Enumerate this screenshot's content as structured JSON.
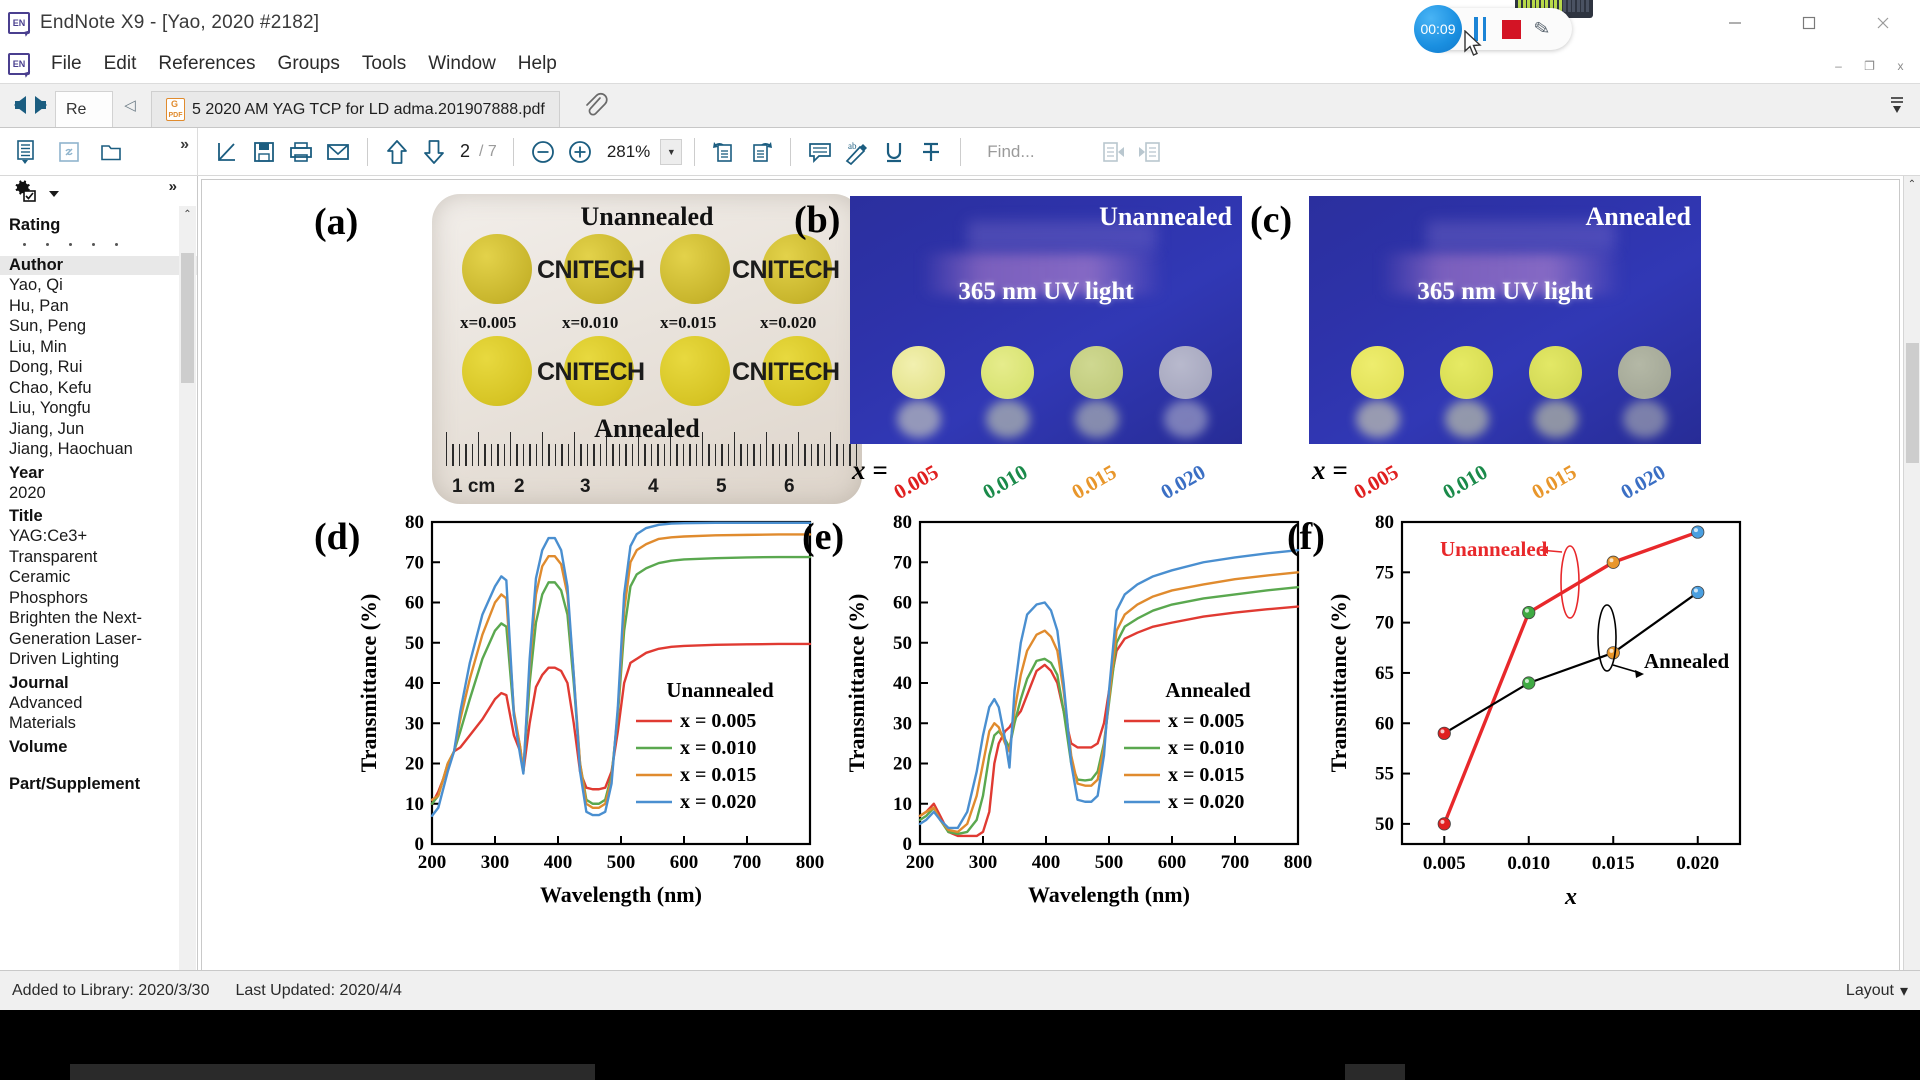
{
  "window": {
    "app_logo": "endnote-logo",
    "title": "EndNote X9 - [Yao, 2020 #2182]",
    "minimize": "—",
    "maximize": "□",
    "close": "✕",
    "doc_minimize": "–",
    "doc_restore": "❐",
    "doc_close": "x"
  },
  "menu": {
    "items": [
      "File",
      "Edit",
      "References",
      "Groups",
      "Tools",
      "Window",
      "Help"
    ]
  },
  "tabbar": {
    "back_icon": "back-arrow-icon",
    "forward_icon": "forward-arrow-icon",
    "reference_tab": "Re",
    "collapse_icon": "collapse-left-icon",
    "pdf_tab": "5 2020 AM YAG TCP for LD adma.201907888.pdf",
    "pdf_badge": "PDF",
    "attachment_icon": "paperclip-icon",
    "overflow_icon": "overflow-menu-icon"
  },
  "library_toolbar": {
    "icons": [
      "list-view-icon",
      "link-icon",
      "open-folder-icon"
    ],
    "overflow": "»"
  },
  "pdf_toolbar": {
    "icons": {
      "open_external": "open-in-new-icon",
      "save": "save-icon",
      "print": "print-icon",
      "email": "email-icon",
      "prev_page": "up-arrow-icon",
      "next_page": "down-arrow-icon",
      "zoom_out": "zoom-out-icon",
      "zoom_in": "zoom-in-icon",
      "zoom_dropdown": "chevron-down-icon",
      "rotate_left": "rotate-left-icon",
      "rotate_right": "rotate-right-icon",
      "sticky_note": "sticky-note-icon",
      "highlight": "highlight-pen-icon",
      "underline": "underline-icon",
      "strikethrough": "strikethrough-icon",
      "find_prev": "find-previous-icon",
      "find_next": "find-next-icon"
    },
    "page_current": "2",
    "page_total": "/ 7",
    "zoom_level": "281%",
    "find_placeholder": "Find..."
  },
  "left_panel": {
    "settings_icon": "gear-settings-icon",
    "dropdown_icon": "chevron-down-icon",
    "overflow": "»",
    "fields": [
      {
        "label": "Rating",
        "type": "rating",
        "dots": 5
      },
      {
        "label": "Author",
        "highlight": true,
        "values": [
          "Yao, Qi",
          "Hu, Pan",
          "Sun, Peng",
          "Liu, Min",
          "Dong, Rui",
          "Chao, Kefu",
          "Liu, Yongfu",
          "Jiang, Jun",
          "Jiang, Haochuan"
        ]
      },
      {
        "label": "Year",
        "values": [
          "2020"
        ]
      },
      {
        "label": "Title",
        "values": [
          "YAG:Ce3+",
          " Transparent",
          "Ceramic",
          "Phosphors",
          "Brighten the Next-",
          "Generation Laser-",
          "Driven Lighting"
        ]
      },
      {
        "label": "Journal",
        "values": [
          "Advanced",
          "Materials"
        ]
      },
      {
        "label": "Volume",
        "values": [
          ""
        ]
      },
      {
        "label": "Part/Supplement",
        "values": []
      }
    ]
  },
  "status_bar": {
    "added": "Added to Library: 2020/3/30",
    "updated": "Last Updated: 2020/4/4",
    "layout": "Layout",
    "layout_caret": "▾"
  },
  "recorder": {
    "timer": "00:09",
    "pause_icon": "pause-icon",
    "stop_icon": "stop-record-icon",
    "pen_icon": "pencil-annotate-icon"
  },
  "figure": {
    "panels": {
      "a": {
        "label": "(a)",
        "top_title": "Unannealed",
        "bottom_title": "Annealed",
        "logo_text": "CNITECH",
        "x_labels": [
          "x=0.005",
          "x=0.010",
          "x=0.015",
          "x=0.020"
        ],
        "ruler_numbers": [
          "1 cm",
          "2",
          "3",
          "4",
          "5",
          "6"
        ]
      },
      "b": {
        "label": "(b)",
        "title": "Unannealed",
        "uv_text": "365 nm UV light",
        "x_prefix": "x =",
        "x_values": [
          "0.005",
          "0.010",
          "0.015",
          "0.020"
        ],
        "x_colors": [
          "#e02020",
          "#1a8a4a",
          "#e8962b",
          "#3b6fc4"
        ]
      },
      "c": {
        "label": "(c)",
        "title": "Annealed",
        "uv_text": "365 nm UV light",
        "x_prefix": "x =",
        "x_values": [
          "0.005",
          "0.010",
          "0.015",
          "0.020"
        ],
        "x_colors": [
          "#e02020",
          "#1a8a4a",
          "#e8962b",
          "#3b6fc4"
        ]
      },
      "d": {
        "label": "(d)"
      },
      "e": {
        "label": "(e)"
      },
      "f": {
        "label": "(f)"
      }
    }
  },
  "chart_data": [
    {
      "id": "d",
      "type": "line",
      "title": "Unannealed",
      "xlabel": "Wavelength (nm)",
      "ylabel": "Transmittance (%)",
      "xlim": [
        200,
        800
      ],
      "ylim": [
        0,
        80
      ],
      "xticks": [
        200,
        300,
        400,
        500,
        600,
        700,
        800
      ],
      "yticks": [
        0,
        10,
        20,
        30,
        40,
        50,
        60,
        70,
        80
      ],
      "legend_position": "lower-right",
      "colors": [
        "#e03a32",
        "#5aa84f",
        "#e08b2e",
        "#4a8fd0"
      ],
      "x": [
        200,
        210,
        225,
        235,
        245,
        260,
        280,
        300,
        310,
        318,
        330,
        340,
        345,
        355,
        365,
        375,
        385,
        395,
        405,
        415,
        425,
        435,
        445,
        455,
        465,
        475,
        485,
        495,
        505,
        515,
        525,
        540,
        560,
        580,
        600,
        650,
        700,
        750,
        800
      ],
      "series": [
        {
          "name": "x = 0.005",
          "values": [
            10,
            13,
            19,
            23,
            24,
            27,
            31,
            36,
            37.5,
            37,
            27,
            23,
            18,
            30,
            39,
            42,
            43.8,
            43.8,
            43,
            40,
            30,
            18,
            14,
            13.6,
            13.6,
            14,
            18,
            28,
            40,
            45,
            46,
            47.5,
            48.5,
            49,
            49.2,
            49.5,
            49.6,
            49.7,
            49.7
          ]
        },
        {
          "name": "x = 0.010",
          "values": [
            10,
            12,
            20,
            23,
            28,
            36,
            46,
            53,
            54.8,
            54,
            32,
            24,
            18,
            40,
            55,
            62,
            65,
            65,
            63,
            57,
            40,
            20,
            11,
            10,
            10,
            11,
            17,
            32,
            53,
            64,
            67,
            68.5,
            69.8,
            70.4,
            70.7,
            71,
            71.2,
            71.3,
            71.3
          ]
        },
        {
          "name": "x = 0.015",
          "values": [
            11,
            12,
            20,
            23,
            31,
            41,
            52,
            60,
            62,
            61,
            33,
            24,
            18,
            44,
            62,
            69,
            71.5,
            71.5,
            69.5,
            62,
            42,
            20,
            10,
            9,
            9,
            10,
            16,
            33,
            58,
            70,
            73,
            74.5,
            75.8,
            76.2,
            76.4,
            76.7,
            76.8,
            76.9,
            76.9
          ]
        },
        {
          "name": "x = 0.020",
          "values": [
            7,
            9,
            18,
            23,
            33,
            45,
            57,
            64,
            66.5,
            65.5,
            32,
            22,
            17.5,
            46,
            66,
            73,
            76,
            76,
            73,
            64,
            42,
            18,
            8,
            7.2,
            7.2,
            8,
            15,
            34,
            62,
            74,
            77,
            78.5,
            79.3,
            79.6,
            79.7,
            79.8,
            79.8,
            79.8,
            79.8
          ]
        }
      ]
    },
    {
      "id": "e",
      "type": "line",
      "title": "Annealed",
      "xlabel": "Wavelength (nm)",
      "ylabel": "Transmittance (%)",
      "xlim": [
        200,
        800
      ],
      "ylim": [
        0,
        80
      ],
      "xticks": [
        200,
        300,
        400,
        500,
        600,
        700,
        800
      ],
      "yticks": [
        0,
        10,
        20,
        30,
        40,
        50,
        60,
        70,
        80
      ],
      "legend_position": "lower-right",
      "colors": [
        "#e03a32",
        "#5aa84f",
        "#e08b2e",
        "#4a8fd0"
      ],
      "x": [
        200,
        210,
        222,
        232,
        245,
        260,
        275,
        290,
        300,
        310,
        318,
        325,
        335,
        342,
        350,
        360,
        370,
        385,
        398,
        408,
        418,
        428,
        440,
        450,
        462,
        472,
        482,
        492,
        500,
        512,
        525,
        545,
        570,
        600,
        650,
        700,
        750,
        800
      ],
      "series": [
        {
          "name": "x = 0.005",
          "values": [
            7,
            8,
            10,
            7,
            3,
            2,
            2,
            2,
            3,
            8,
            20,
            25,
            28,
            29,
            31,
            33,
            37,
            43,
            44.5,
            43,
            40,
            33,
            25,
            24,
            24,
            24,
            25,
            30,
            38,
            48,
            51,
            52.5,
            54,
            55,
            56.5,
            57.5,
            58.3,
            59
          ]
        },
        {
          "name": "x = 0.010",
          "values": [
            6,
            7,
            9,
            6,
            3,
            2.5,
            3,
            6,
            12,
            22,
            27,
            28,
            26,
            24,
            30,
            36,
            41,
            45.5,
            46,
            45,
            42,
            33,
            20,
            16,
            15.8,
            16,
            18,
            25,
            35,
            50,
            54,
            56,
            58,
            59.5,
            61,
            62,
            63,
            63.8
          ]
        },
        {
          "name": "x = 0.015",
          "values": [
            7,
            8,
            9,
            6,
            3.5,
            3,
            5,
            12,
            20,
            28,
            30,
            29,
            25,
            23,
            33,
            42,
            48,
            52,
            53,
            51.5,
            48,
            38,
            22,
            15,
            14.5,
            14.5,
            16,
            24,
            36,
            53,
            57,
            59.5,
            61.5,
            63,
            64.5,
            65.8,
            66.7,
            67.5
          ]
        },
        {
          "name": "x = 0.020",
          "values": [
            5,
            6,
            8,
            6,
            4,
            4,
            8,
            18,
            27,
            34,
            36,
            34,
            26,
            19,
            38,
            50,
            57,
            59.5,
            60,
            58,
            53,
            40,
            20,
            11,
            10.5,
            10.5,
            12,
            22,
            38,
            58,
            62,
            64.5,
            66.5,
            68,
            70,
            71.2,
            72.2,
            73
          ]
        }
      ]
    },
    {
      "id": "f",
      "type": "line",
      "title": "",
      "xlabel": "x",
      "ylabel": "Transmittance (%)",
      "xlim": [
        0.0025,
        0.0225
      ],
      "ylim": [
        48,
        80
      ],
      "xticks": [
        0.005,
        0.01,
        0.015,
        0.02
      ],
      "xticklabels": [
        "0.005",
        "0.010",
        "0.015",
        "0.020"
      ],
      "yticks": [
        50,
        55,
        60,
        65,
        70,
        75,
        80
      ],
      "annotations": [
        "Unannealed",
        "Annealed"
      ],
      "annotation_colors": [
        "#e8282b",
        "#000000"
      ],
      "marker_colors": [
        "#e02020",
        "#3faa43",
        "#e8962b",
        "#4a9fe0"
      ],
      "categories": [
        0.005,
        0.01,
        0.015,
        0.02
      ],
      "series": [
        {
          "name": "Unannealed",
          "color": "#e8282b",
          "values": [
            50,
            71,
            76,
            79
          ]
        },
        {
          "name": "Annealed",
          "color": "#000000",
          "values": [
            59,
            64,
            67,
            73
          ]
        }
      ]
    }
  ]
}
